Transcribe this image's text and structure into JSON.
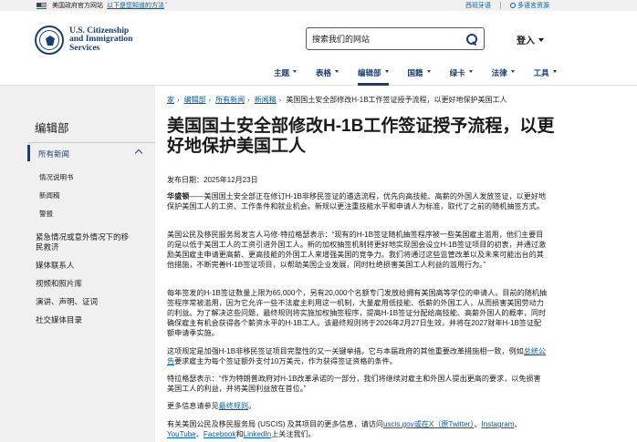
{
  "gov_banner": {
    "official_text": "美国政府官方网站",
    "how_know_link": "以下是您知道的方法"
  },
  "lang_links": {
    "spanish": "西班牙语",
    "multilang": "多语言资源"
  },
  "logo": {
    "line1": "U.S. Citizenship",
    "line2": "and Immigration",
    "line3": "Services"
  },
  "search": {
    "placeholder": "搜索我们的网站"
  },
  "login": "登入",
  "nav": [
    {
      "label": "主题"
    },
    {
      "label": "表格"
    },
    {
      "label": "编辑部"
    },
    {
      "label": "国籍"
    },
    {
      "label": "绿卡"
    },
    {
      "label": "法律"
    },
    {
      "label": "工具"
    }
  ],
  "sidebar": {
    "heading": "编辑部",
    "selected": "所有新闻",
    "subitems": [
      "情况说明书",
      "新闻稿",
      "警报"
    ],
    "items": [
      "紧急情况或意外情况下的移民救济",
      "媒体联系人",
      "视频和照片库",
      "演讲、声明、证词",
      "社交媒体目录"
    ]
  },
  "breadcrumb": {
    "items": [
      "家",
      "编辑部",
      "所有新闻",
      "新闻稿"
    ],
    "current": "美国国土安全部修改H-1B工作签证授予流程，以更好地保护美国工人"
  },
  "article": {
    "title": "美国国土安全部修改H-1B工作签证授予流程，以更好地保护美国工人",
    "date": "发布日期：2025年12月23日",
    "p1_lead": "华盛顿",
    "p1": "——美国国土安全部正在修订H-1B非移民签证的遴选流程，优先向高技能、高薪的外国人发放签证，以更好地保护美国工人的工资、工作条件和就业机会。新规以更注重技能水平和申请人为标准，取代了之前的随机抽签方式。",
    "p2": "美国公民及移民服务局发言人马修·特拉格瑟表示：“现有的H-1B签证随机抽签程序被一些美国雇主滥用，他们主要目的是以低于美国工人的工资引进外国工人。新的加权抽签机制将更好地实现国会设立H-1B签证项目的初衷，并通过激励美国雇主申请更高薪、更高技能的外国工人来增强美国的竞争力。我们将通过这些监管改革以及未来可能出台的其他措施，不断完善H-1B签证项目，以帮助美国企业发展，同时杜绝损害美国工人利益的滥用行为。”",
    "p3": "每年签发的H-1B签证数量上限为65,000个，另有20,000个名额专门发放给拥有美国高等学位的申请人。目前的随机抽签程序常被滥用，因为它允许一些不法雇主利用这一机制，大量雇用低技能、低薪的外国工人，从而损害美国劳动力的利益。为了解决这些问题，最终规则将实施加权抽签程序，提高H-1B签证分配给高技能、高薪外国人的概率，同时确保雇主有机会获得各个薪资水平的H-1B工人。该最终规则将于2026年2月27日生效，并将在2027财年H-1B签证配额申请季实施。",
    "p4_before": "这项规定是加强H-1B非移民签证项目完整性的又一关键举措。它与本届政府的其他重要改革措施相一致，例如",
    "p4_link": "总统公告",
    "p4_after": "要求雇主为每个签证额外支付10万美元，作为获得签证资格的条件。",
    "p5": "特拉格瑟表示：“作为特朗普政府对H-1B改革承诺的一部分，我们将继续对雇主和外国人提出更高的要求，以免损害美国工人的利益，并将美国利益放在首位。”",
    "p6_before": "更多信息请参见",
    "p6_link": "最终规则",
    "p6_after": "。",
    "p7_before": "有关美国公民及移民服务局 (USCIS) 及其项目的更多信息，请访问",
    "p7_link1": "uscis.gov或在X（原Twitter）",
    "p7_sep1": "、",
    "p7_link2": "Instagram",
    "p7_sep2": "、",
    "p7_link3": "YouTube",
    "p7_sep3": "、",
    "p7_link4": "Facebook",
    "p7_sep4": "和",
    "p7_link5": "LinkedIn",
    "p7_after": "上关注我们。"
  },
  "colors": {
    "brand": "#1a3e72",
    "link": "#005ea2",
    "sidebar_bg": "#f0f0f0"
  }
}
